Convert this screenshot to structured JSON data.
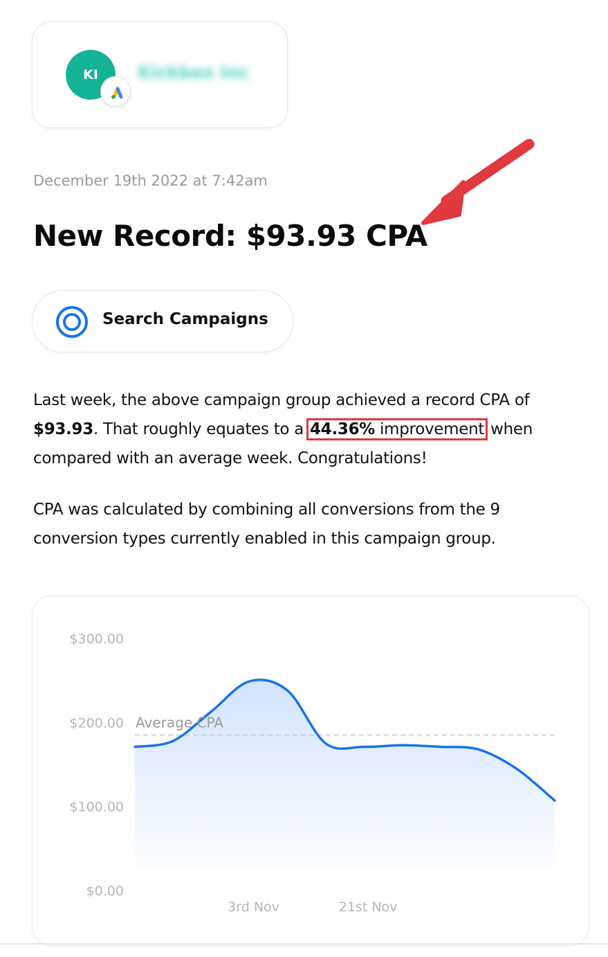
{
  "account": {
    "initials": "KI",
    "name": "Kickbox Inc",
    "badge_icon": "google-ads-icon",
    "avatar_color": "#15b396"
  },
  "timestamp": "December 19th 2022 at 7:42am",
  "headline": "New Record: $93.93 CPA",
  "campaign": {
    "icon": "target-icon",
    "label": "Search Campaigns",
    "accent": "#1a73e8"
  },
  "paragraph1": {
    "intro": "Last week, the above campaign group achieved a record CPA of ",
    "cpa_value": "$93.93",
    "middle": ". That roughly equates to a ",
    "improvement_value": "44.36%",
    "improvement_word": " improvement",
    "outro": " when compared with an average week. Congratulations!"
  },
  "paragraph2": "CPA was calculated by combining all conversions from the 9 conversion types currently enabled in this campaign group.",
  "annotation": {
    "arrow_color": "#e0393e",
    "highlight_color": "#e0393e"
  },
  "chart_data": {
    "type": "area",
    "title": "",
    "xlabel": "",
    "ylabel": "",
    "ylim": [
      0,
      300
    ],
    "y_ticks": [
      "$0.00",
      "$100.00",
      "$200.00",
      "$300.00"
    ],
    "y_tick_values": [
      0,
      100,
      200,
      300
    ],
    "x_tick_labels": [
      "3rd Nov",
      "21st Nov"
    ],
    "series": [
      {
        "values": [
          171,
          178,
          213,
          249,
          238,
          175,
          171,
          173,
          171,
          168,
          145,
          107
        ],
        "color": "#1a73e8"
      }
    ],
    "reference_line": {
      "label": "Average CPA",
      "value": 185
    },
    "grid": false,
    "legend": "none"
  }
}
